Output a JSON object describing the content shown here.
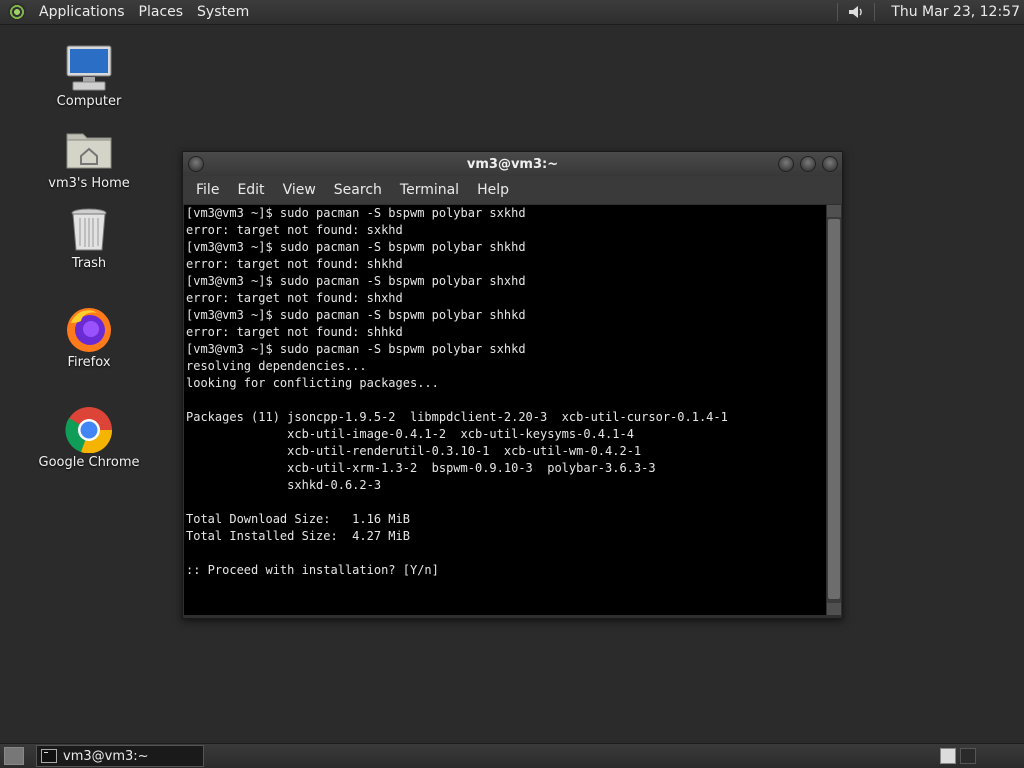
{
  "top_panel": {
    "menus": [
      "Applications",
      "Places",
      "System"
    ],
    "clock": "Thu Mar 23, 12:57"
  },
  "desktop": {
    "icons": [
      {
        "label": "Computer",
        "icon": "computer-icon"
      },
      {
        "label": "vm3's Home",
        "icon": "home-folder-icon"
      },
      {
        "label": "Trash",
        "icon": "trash-icon"
      },
      {
        "label": "Firefox",
        "icon": "firefox-icon"
      },
      {
        "label": "Google Chrome",
        "icon": "chrome-icon"
      }
    ]
  },
  "terminal": {
    "title": "vm3@vm3:~",
    "menu": [
      "File",
      "Edit",
      "View",
      "Search",
      "Terminal",
      "Help"
    ],
    "lines": [
      "[vm3@vm3 ~]$ sudo pacman -S bspwm polybar sxkhd",
      "error: target not found: sxkhd",
      "[vm3@vm3 ~]$ sudo pacman -S bspwm polybar shkhd",
      "error: target not found: shkhd",
      "[vm3@vm3 ~]$ sudo pacman -S bspwm polybar shxhd",
      "error: target not found: shxhd",
      "[vm3@vm3 ~]$ sudo pacman -S bspwm polybar shhkd",
      "error: target not found: shhkd",
      "[vm3@vm3 ~]$ sudo pacman -S bspwm polybar sxhkd",
      "resolving dependencies...",
      "looking for conflicting packages...",
      "",
      "Packages (11) jsoncpp-1.9.5-2  libmpdclient-2.20-3  xcb-util-cursor-0.1.4-1",
      "              xcb-util-image-0.4.1-2  xcb-util-keysyms-0.4.1-4",
      "              xcb-util-renderutil-0.3.10-1  xcb-util-wm-0.4.2-1",
      "              xcb-util-xrm-1.3-2  bspwm-0.9.10-3  polybar-3.6.3-3",
      "              sxhkd-0.6.2-3",
      "",
      "Total Download Size:   1.16 MiB",
      "Total Installed Size:  4.27 MiB",
      "",
      ":: Proceed with installation? [Y/n]"
    ]
  },
  "taskbar": {
    "task_label": "vm3@vm3:~"
  }
}
